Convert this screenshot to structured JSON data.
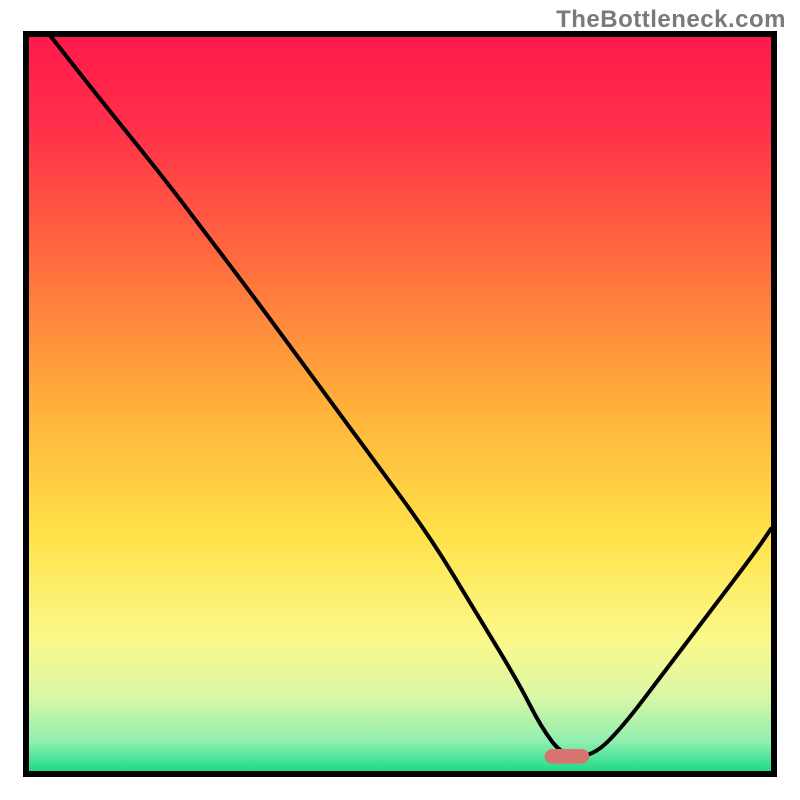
{
  "watermark": "TheBottleneck.com",
  "chart_data": {
    "type": "line",
    "title": "",
    "xlabel": "",
    "ylabel": "",
    "xlim": [
      0,
      100
    ],
    "ylim": [
      0,
      100
    ],
    "grid": false,
    "legend": false,
    "note": "Axis values are estimated from pixel positions; the image carries no tick labels.",
    "background": {
      "type": "gradient",
      "direction": "vertical",
      "stops": [
        {
          "pos": 0.0,
          "color": "#ff1a4b"
        },
        {
          "pos": 0.12,
          "color": "#ff2f4a"
        },
        {
          "pos": 0.3,
          "color": "#ff6a3e"
        },
        {
          "pos": 0.5,
          "color": "#ffb03a"
        },
        {
          "pos": 0.68,
          "color": "#ffe24a"
        },
        {
          "pos": 0.82,
          "color": "#fbf98a"
        },
        {
          "pos": 0.9,
          "color": "#d9f7a7"
        },
        {
          "pos": 0.96,
          "color": "#8fefb0"
        },
        {
          "pos": 1.0,
          "color": "#1edb87"
        }
      ]
    },
    "marker": {
      "x": 72.5,
      "y": 2,
      "color": "#d9736f",
      "w": 6,
      "h": 2
    },
    "series": [
      {
        "name": "curve",
        "x": [
          3,
          10,
          18,
          24,
          30,
          38,
          46,
          54,
          60,
          66,
          69,
          72,
          76,
          80,
          86,
          92,
          98,
          100
        ],
        "y": [
          100,
          91,
          81,
          73,
          65,
          54,
          43,
          32,
          22,
          12,
          6,
          2,
          2,
          6,
          14,
          22,
          30,
          33
        ]
      }
    ]
  }
}
